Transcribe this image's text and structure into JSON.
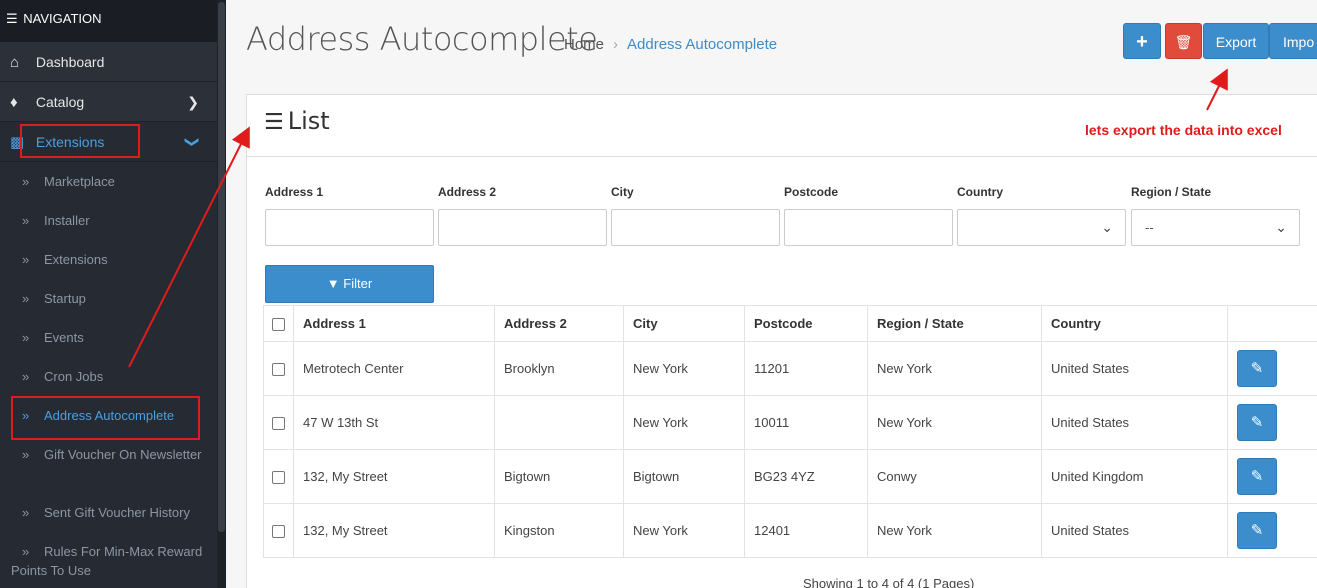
{
  "sidebar": {
    "header": "NAVIGATION",
    "items": [
      {
        "label": "Dashboard",
        "icon": "home-icon"
      },
      {
        "label": "Catalog",
        "icon": "tag-icon"
      },
      {
        "label": "Extensions",
        "icon": "puzzle-icon"
      }
    ],
    "sub_items": [
      {
        "label": "Marketplace"
      },
      {
        "label": "Installer"
      },
      {
        "label": "Extensions"
      },
      {
        "label": "Startup"
      },
      {
        "label": "Events"
      },
      {
        "label": "Cron Jobs"
      },
      {
        "label": "Address Autocomplete"
      },
      {
        "label": "Gift Voucher On Newsletter"
      },
      {
        "label": "Sent Gift Voucher History"
      },
      {
        "label": "Rules For Min-Max Reward Points To Use"
      }
    ]
  },
  "header": {
    "title": "Address Autocomplete",
    "breadcrumb": [
      "Home",
      "Address Autocomplete"
    ],
    "buttons": {
      "add": "+",
      "delete": "🗑",
      "export": "Export",
      "import": "Impo"
    }
  },
  "panel": {
    "title": "List",
    "filters": [
      {
        "label": "Address 1",
        "value": ""
      },
      {
        "label": "Address 2",
        "value": ""
      },
      {
        "label": "City",
        "value": ""
      },
      {
        "label": "Postcode",
        "value": ""
      },
      {
        "label": "Country",
        "value": ""
      },
      {
        "label": "Region / State",
        "value": "--"
      }
    ],
    "filter_button": "Filter",
    "columns": [
      "Address 1",
      "Address 2",
      "City",
      "Postcode",
      "Region / State",
      "Country"
    ],
    "rows": [
      [
        "Metrotech Center",
        "Brooklyn",
        "New York",
        "11201",
        "New York",
        "United States"
      ],
      [
        "47 W 13th St",
        "",
        "New York",
        "10011",
        "New York",
        "United States"
      ],
      [
        "132, My Street",
        "Bigtown",
        "Bigtown",
        "BG23 4YZ",
        "Conwy",
        "United Kingdom"
      ],
      [
        "132, My Street",
        "Kingston",
        "New York",
        "12401",
        "New York",
        "United States"
      ]
    ],
    "pagination_text": "Showing 1 to 4 of 4 (1 Pages)"
  },
  "annotation": {
    "text": "lets export the data into excel",
    "color": "#e01b1b"
  },
  "colors": {
    "primary": "#3c8dcb",
    "danger": "#e04b3b",
    "sidebar_bg": "#252a33",
    "active_link": "#4aa0e0"
  }
}
